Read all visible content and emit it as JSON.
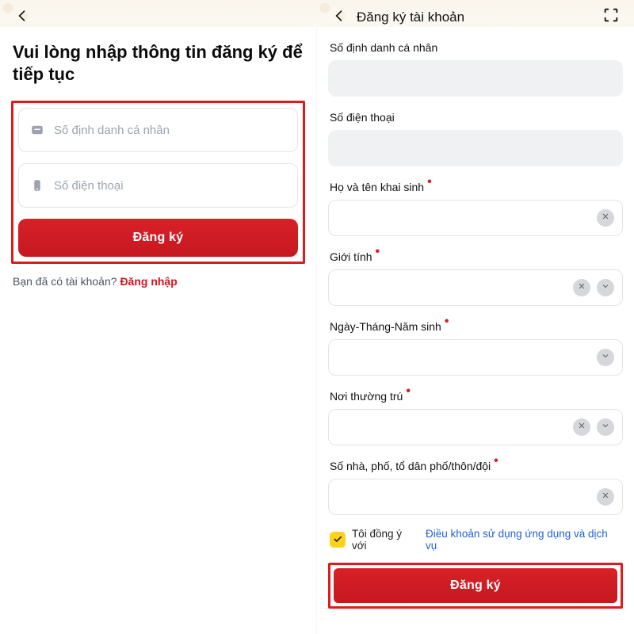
{
  "left": {
    "heading": "Vui lòng nhập thông tin đăng ký để tiếp tục",
    "placeholders": {
      "id": "Số định danh cá nhân",
      "phone": "Số điện thoại"
    },
    "register_btn": "Đăng ký",
    "login_q": "Bạn đã có tài khoản? ",
    "login_link": "Đăng nhập"
  },
  "right": {
    "title": "Đăng ký tài khoản",
    "labels": {
      "id": "Số định danh cá nhân",
      "phone": "Số điện thoại",
      "fullname": "Họ và tên khai sinh",
      "gender": "Giới tính",
      "dob": "Ngày-Tháng-Năm sinh",
      "residence": "Nơi thường trú",
      "address": "Số nhà, phố, tổ dân phố/thôn/đội"
    },
    "agree_prefix": "Tôi đồng ý với ",
    "terms_link": "Điều khoản sử dụng ứng dụng và dịch vụ",
    "register_btn": "Đăng ký"
  }
}
